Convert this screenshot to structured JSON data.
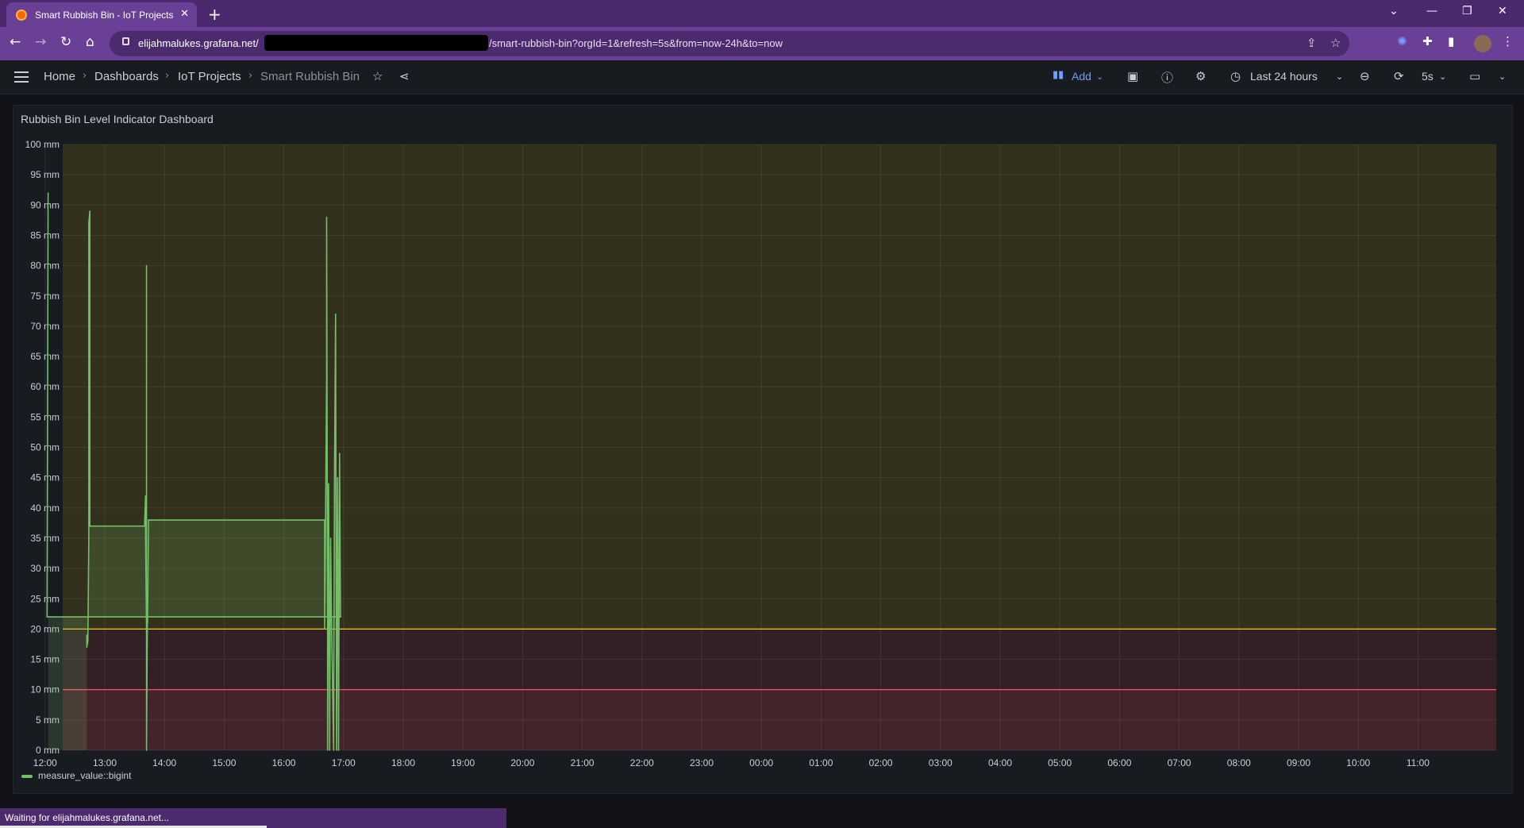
{
  "browser": {
    "tab_title": "Smart Rubbish Bin - IoT Projects",
    "url_host": "elijahmalukes.grafana.net/",
    "url_path": "/smart-rubbish-bin?orgId=1&refresh=5s&from=now-24h&to=now",
    "status_text": "Waiting for elijahmalukes.grafana.net..."
  },
  "grafana": {
    "breadcrumbs": [
      "Home",
      "Dashboards",
      "IoT Projects",
      "Smart Rubbish Bin"
    ],
    "add_label": "Add",
    "time_range": "Last 24 hours",
    "refresh_interval": "5s"
  },
  "panel": {
    "title": "Rubbish Bin Level Indicator Dashboard"
  },
  "chart_data": {
    "type": "line",
    "title": "Rubbish Bin Level Indicator Dashboard",
    "ylim": [
      0,
      100
    ],
    "y_ticks": [
      "0 mm",
      "5 mm",
      "10 mm",
      "15 mm",
      "20 mm",
      "25 mm",
      "30 mm",
      "35 mm",
      "40 mm",
      "45 mm",
      "50 mm",
      "55 mm",
      "60 mm",
      "65 mm",
      "70 mm",
      "75 mm",
      "80 mm",
      "85 mm",
      "90 mm",
      "95 mm",
      "100 mm"
    ],
    "x_ticks": [
      "13:00",
      "14:00",
      "15:00",
      "16:00",
      "17:00",
      "18:00",
      "19:00",
      "20:00",
      "21:00",
      "22:00",
      "23:00",
      "00:00",
      "01:00",
      "02:00",
      "03:00",
      "04:00",
      "05:00",
      "06:00",
      "07:00",
      "08:00",
      "09:00",
      "10:00",
      "11:00",
      "12:00"
    ],
    "thresholds": [
      {
        "value": 20,
        "color": "#f2cc0c"
      },
      {
        "value": 10,
        "color": "#f2495c"
      }
    ],
    "series": [
      {
        "name": "measure_value::bigint",
        "color": "#73bf69",
        "points": [
          [
            "12:42",
            19
          ],
          [
            "12:42",
            17
          ],
          [
            "12:43",
            18
          ],
          [
            "12:44",
            35
          ],
          [
            "12:44",
            87
          ],
          [
            "12:45",
            89
          ],
          [
            "12:45",
            37
          ],
          [
            "13:40",
            37
          ],
          [
            "13:41",
            42
          ],
          [
            "13:41",
            35
          ],
          [
            "13:42",
            20
          ],
          [
            "13:42",
            80
          ],
          [
            "13:42",
            0
          ],
          [
            "13:43",
            26
          ],
          [
            "13:43",
            21
          ],
          [
            "13:44",
            38
          ],
          [
            "16:41",
            38
          ],
          [
            "16:41",
            20
          ],
          [
            "16:42",
            39
          ],
          [
            "16:43",
            62
          ],
          [
            "16:43",
            88
          ],
          [
            "16:44",
            20
          ],
          [
            "16:44",
            0
          ],
          [
            "16:45",
            44
          ],
          [
            "16:46",
            0
          ],
          [
            "16:47",
            35
          ],
          [
            "16:48",
            20
          ],
          [
            "16:50",
            0
          ],
          [
            "16:51",
            47
          ],
          [
            "16:52",
            72
          ],
          [
            "16:53",
            0
          ],
          [
            "16:54",
            45
          ],
          [
            "16:55",
            0
          ],
          [
            "16:56",
            49
          ],
          [
            "16:57",
            22
          ],
          [
            "12:02",
            22
          ],
          [
            "12:03",
            92
          ]
        ]
      }
    ],
    "legend_position": "bottom-left"
  }
}
